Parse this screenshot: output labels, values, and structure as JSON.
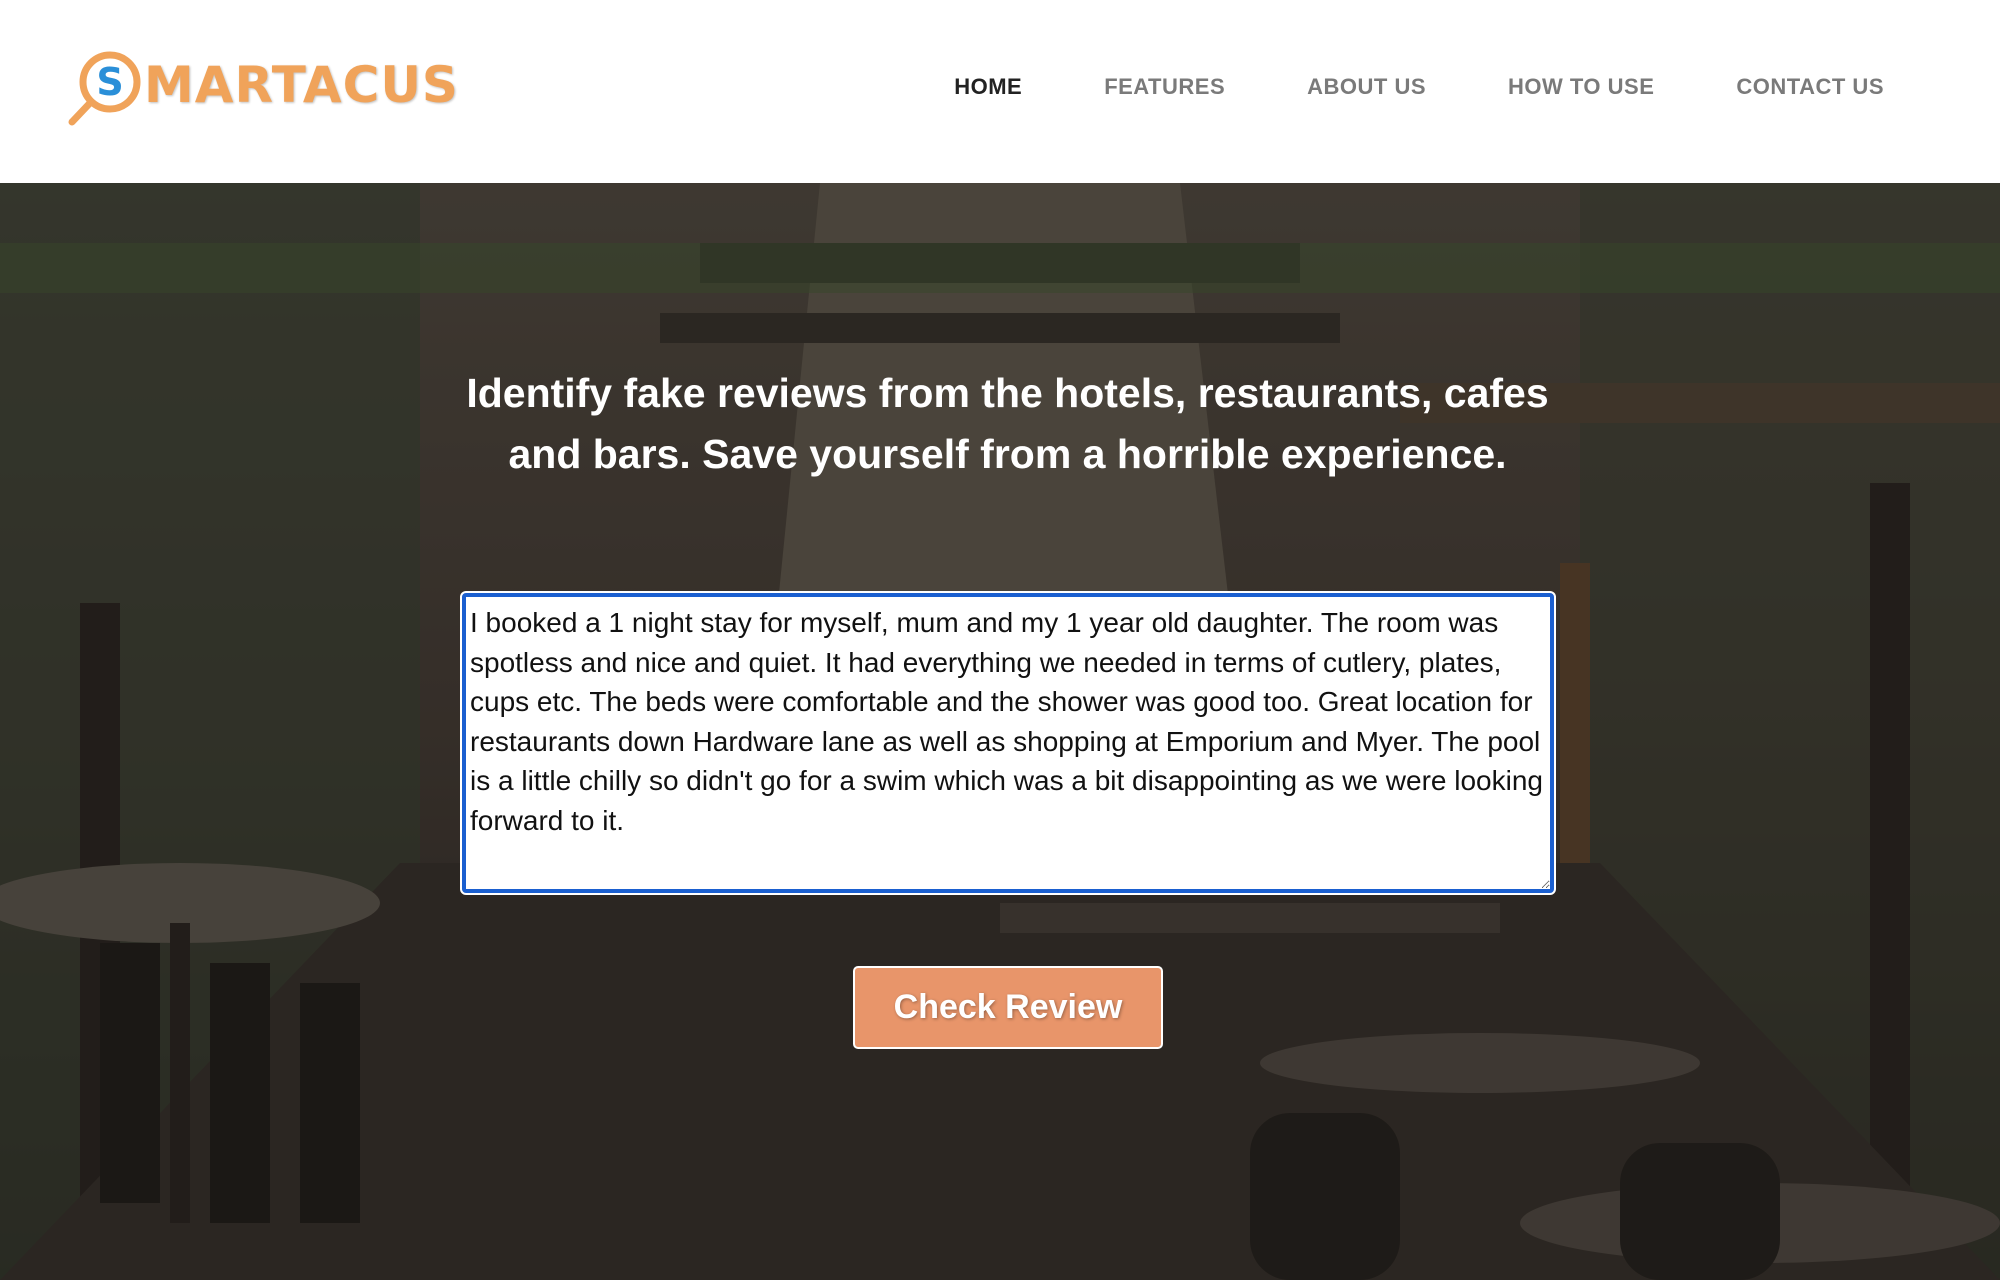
{
  "brand": {
    "logo_text": "MARTACUS",
    "logo_letter": "S",
    "accent": "#f0a35a"
  },
  "nav": {
    "items": [
      {
        "label": "HOME",
        "active": true
      },
      {
        "label": "FEATURES",
        "active": false
      },
      {
        "label": "ABOUT US",
        "active": false
      },
      {
        "label": "HOW TO USE",
        "active": false
      },
      {
        "label": "CONTACT US",
        "active": false
      }
    ]
  },
  "hero": {
    "headline": "Identify fake reviews from the hotels, restaurants, cafes and bars. Save yourself from a horrible experience.",
    "review_value": "I booked a 1 night stay for myself, mum and my 1 year old daughter. The room was spotless and nice and quiet. It had everything we needed in terms of cutlery, plates, cups etc. The beds were comfortable and the shower was good too. Great location for restaurants down Hardware lane as well as shopping at Emporium and Myer. The pool is a little chilly so didn't go for a swim which was a bit disappointing as we were looking forward to it.",
    "button_label": "Check Review",
    "button_color": "#e8956a",
    "focus_color": "#1a5fd0"
  }
}
